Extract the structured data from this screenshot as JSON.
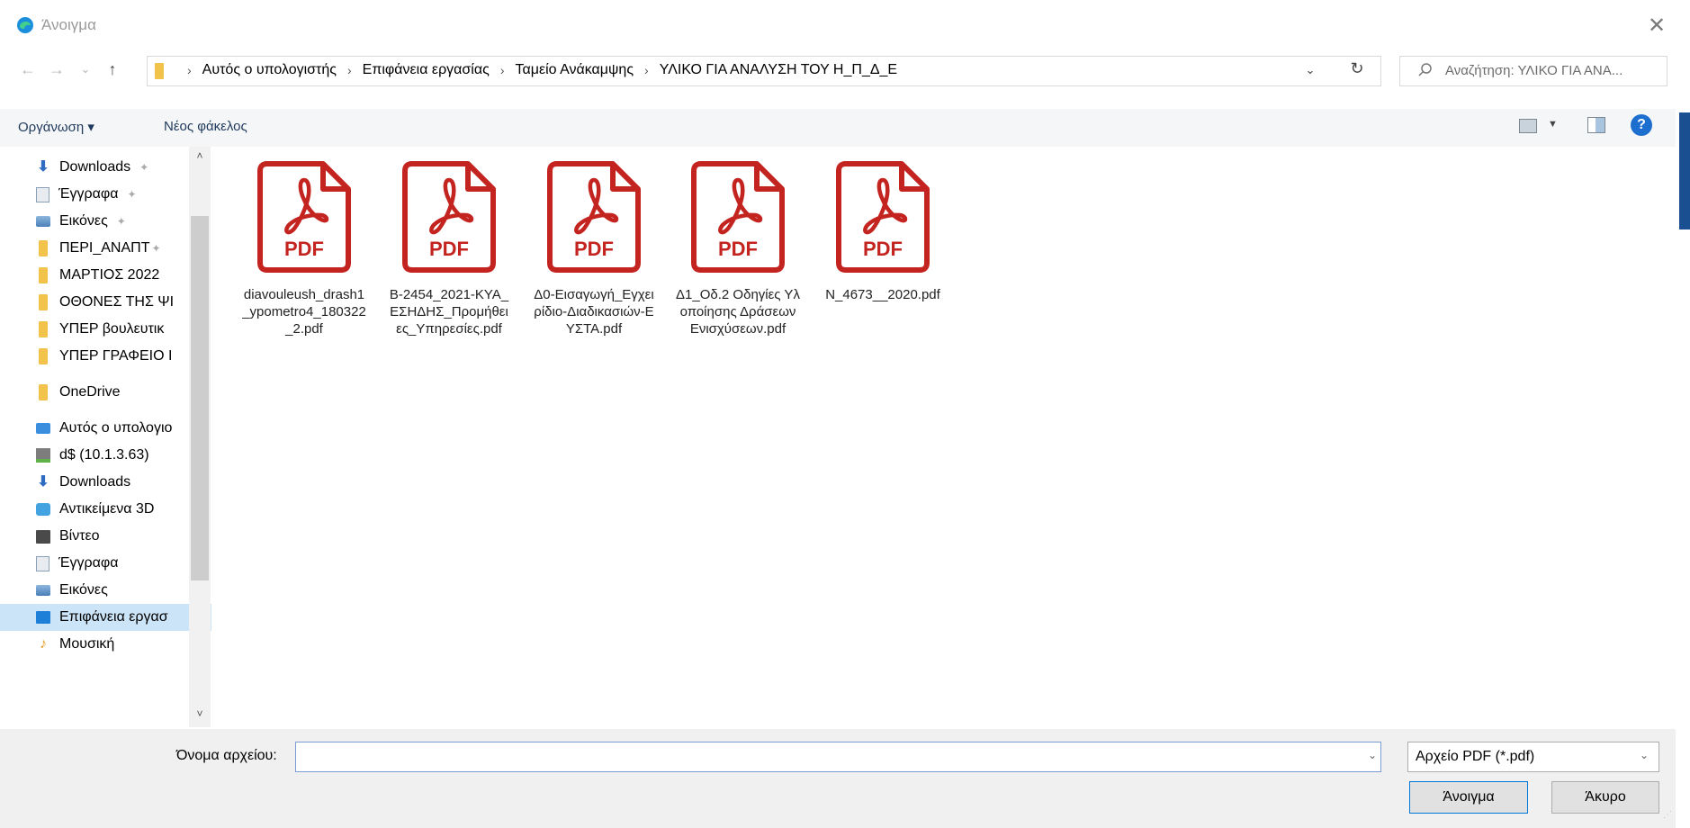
{
  "window": {
    "title": "Άνοιγμα",
    "close_glyph": "✕",
    "accent_color": "#1a4f91"
  },
  "nav": {
    "back_glyph": "←",
    "forward_glyph": "→",
    "recent_glyph": "⌄",
    "up_glyph": "↑",
    "breadcrumb": [
      "Αυτός ο υπολογιστής",
      "Επιφάνεια εργασίας",
      "Ταμείο Ανάκαμψης",
      "ΥΛΙΚΟ ΓΙΑ ΑΝΑΛΥΣΗ ΤΟΥ Η_Π_Δ_Ε"
    ],
    "separator": "›",
    "dropdown_glyph": "⌄",
    "refresh_glyph": "↻"
  },
  "search": {
    "placeholder": "Αναζήτηση: ΥΛΙΚΟ ΓΙΑ ΑΝΑ..."
  },
  "toolbar": {
    "organize_label": "Οργάνωση ▾",
    "new_folder_label": "Νέος φάκελος",
    "view_dd_glyph": "▼",
    "help_glyph": "?"
  },
  "sidebar": {
    "items": [
      {
        "label": "Downloads",
        "icon": "download-icon",
        "pinned": true
      },
      {
        "label": "Έγγραφα",
        "icon": "document-icon",
        "pinned": true
      },
      {
        "label": "Εικόνες",
        "icon": "pictures-icon",
        "pinned": true
      },
      {
        "label": "ΠΕΡΙ_ΑΝΑΠΤ",
        "icon": "folder-icon",
        "pinned": true
      },
      {
        "label": "ΜΑΡΤΙΟΣ 2022",
        "icon": "folder-icon",
        "pinned": false
      },
      {
        "label": "ΟΘΟΝΕΣ ΤΗΣ ΨΙ",
        "icon": "folder-icon",
        "pinned": false
      },
      {
        "label": "ΥΠΕΡ βουλευτικ",
        "icon": "folder-icon",
        "pinned": false
      },
      {
        "label": "ΥΠΕΡ ΓΡΑΦΕΙΟ Ι",
        "icon": "folder-icon",
        "pinned": false
      },
      {
        "label": "OneDrive",
        "icon": "folder-icon",
        "pinned": false
      },
      {
        "label": "Αυτός ο υπολογιο",
        "icon": "computer-icon",
        "pinned": false
      },
      {
        "label": "d$ (10.1.3.63)",
        "icon": "network-drive-icon",
        "pinned": false
      },
      {
        "label": "Downloads",
        "icon": "download-icon",
        "pinned": false
      },
      {
        "label": "Αντικείμενα 3D",
        "icon": "3d-objects-icon",
        "pinned": false
      },
      {
        "label": "Βίντεο",
        "icon": "video-icon",
        "pinned": false
      },
      {
        "label": "Έγγραφα",
        "icon": "document-icon",
        "pinned": false
      },
      {
        "label": "Εικόνες",
        "icon": "pictures-icon",
        "pinned": false
      },
      {
        "label": "Επιφάνεια εργασ",
        "icon": "desktop-icon",
        "pinned": false,
        "selected": true
      },
      {
        "label": "Μουσική",
        "icon": "music-icon",
        "pinned": false
      }
    ],
    "pin_glyph": "📌",
    "scroll_up_glyph": "˄",
    "scroll_down_glyph": "˅"
  },
  "files": [
    {
      "name": "diavouleush_drash1_ypometro4_180322_2.pdf",
      "icon": "pdf-file-icon",
      "badge": "PDF"
    },
    {
      "name": "B-2454_2021-ΚΥΑ_ΕΣΗΔΗΣ_Προμήθειες_Υπηρεσίες.pdf",
      "icon": "pdf-file-icon",
      "badge": "PDF"
    },
    {
      "name": "Δ0-Εισαγωγή_Εγχειρίδιο-Διαδικασιών-ΕΥΣΤΑ.pdf",
      "icon": "pdf-file-icon",
      "badge": "PDF"
    },
    {
      "name": "Δ1_Οδ.2 Οδηγίες Υλοποίησης Δράσεων Ενισχύσεων.pdf",
      "icon": "pdf-file-icon",
      "badge": "PDF"
    },
    {
      "name": "N_4673__2020.pdf",
      "icon": "pdf-file-icon",
      "badge": "PDF"
    }
  ],
  "pdf_color": "#c4241f",
  "footer": {
    "filename_label": "Όνομα αρχείου:",
    "filename_value": "",
    "filetype_value": "Αρχείο PDF (*.pdf)",
    "open_button": "Άνοιγμα",
    "cancel_button": "Άκυρο",
    "dd_glyph": "⌄"
  }
}
